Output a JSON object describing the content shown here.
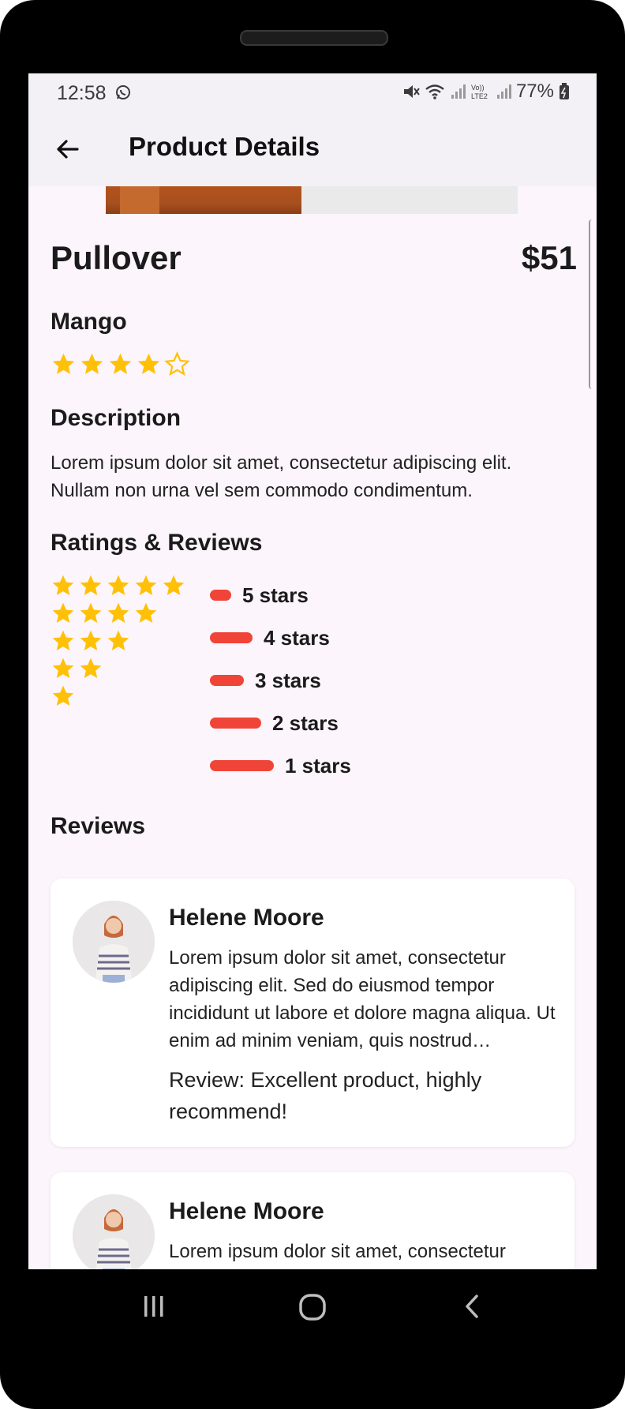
{
  "status_bar": {
    "time": "12:58",
    "battery": "77%"
  },
  "app_bar": {
    "title": "Product Details"
  },
  "product": {
    "name": "Pullover",
    "price": "$51",
    "brand": "Mango",
    "rating": 4,
    "rating_max": 5,
    "description_heading": "Description",
    "description": "Lorem ipsum dolor sit amet, consectetur adipiscing elit. Nullam non urna vel sem commodo condimentum."
  },
  "ratings": {
    "heading": "Ratings & Reviews",
    "star_rows": [
      5,
      4,
      3,
      2,
      1
    ],
    "bars": [
      {
        "label": "5 stars",
        "level": 0.3
      },
      {
        "label": "4 stars",
        "level": 0.6
      },
      {
        "label": "3 stars",
        "level": 0.48
      },
      {
        "label": "2 stars",
        "level": 0.72
      },
      {
        "label": "1 stars",
        "level": 0.9
      }
    ]
  },
  "reviews": {
    "heading": "Reviews",
    "items": [
      {
        "name": "Helene Moore",
        "text": "Lorem ipsum dolor sit amet, consectetur adipiscing elit. Sed do eiusmod tempor incididunt ut labore et dolore magna aliqua. Ut enim ad minim veniam, quis nostrud exercitation ullamco laboris.",
        "review": "Review: Excellent product, highly recommend!"
      },
      {
        "name": "Helene Moore",
        "text": "Lorem ipsum dolor sit amet, consectetur adipiscing elit. Sed do eiusmod tempor incididunt ut labore et dolore magna aliqua.",
        "review": ""
      }
    ]
  },
  "colors": {
    "star": "#ffc107",
    "bar": "#f04438",
    "background": "#fcf5fb",
    "app_bar": "#f3f1f6"
  },
  "icons": [
    "back-arrow-icon",
    "whatsapp-icon",
    "mute-icon",
    "wifi-icon",
    "signal-icon",
    "battery-icon",
    "recents-icon",
    "home-icon",
    "nav-back-icon"
  ]
}
